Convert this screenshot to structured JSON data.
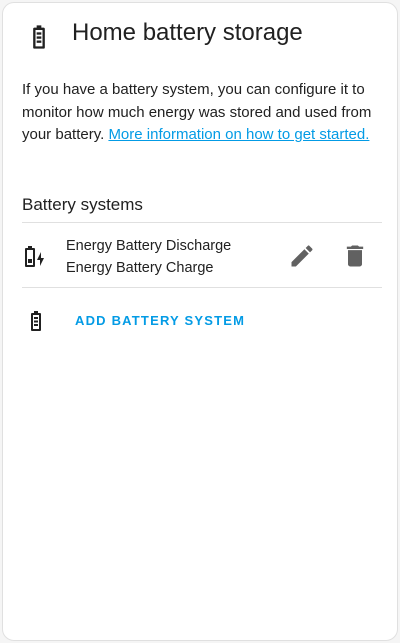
{
  "dialog": {
    "title": "Home battery storage",
    "description": "If you have a battery system, you can configure it to monitor how much energy was stored and used from your battery. ",
    "link_text": "More information on how to get started.",
    "section_title": "Battery systems",
    "battery_rows": [
      {
        "discharge": "Energy Battery Discharge",
        "charge": "Energy Battery Charge"
      }
    ],
    "add_button_label": "ADD BATTERY SYSTEM"
  },
  "colors": {
    "accent": "#039be5",
    "icon": "#212121",
    "action_icon": "#616161"
  },
  "icons": {
    "header": "battery-icon",
    "row": "battery-charging-icon",
    "edit": "pencil-icon",
    "delete": "trash-icon",
    "add": "battery-icon"
  }
}
